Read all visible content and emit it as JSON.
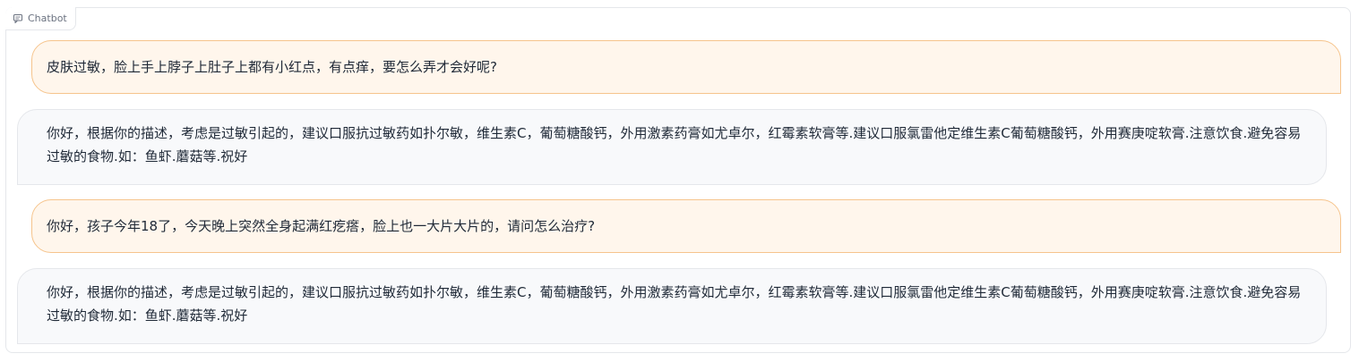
{
  "panel": {
    "label": "Chatbot",
    "icon": "chat-icon"
  },
  "messages": [
    {
      "role": "user",
      "text": "皮肤过敏，脸上手上脖子上肚子上都有小红点，有点痒，要怎么弄才会好呢?"
    },
    {
      "role": "bot",
      "text": "你好，根据你的描述，考虑是过敏引起的，建议口服抗过敏药如扑尔敏，维生素C，葡萄糖酸钙，外用激素药膏如尤卓尔，红霉素软膏等.建议口服氯雷他定维生素C葡萄糖酸钙，外用赛庚啶软膏.注意饮食.避免容易过敏的食物.如：鱼虾.蘑菇等.祝好"
    },
    {
      "role": "user",
      "text": "你好，孩子今年18了，今天晚上突然全身起满红疙瘩，脸上也一大片大片的，请问怎么治疗?"
    },
    {
      "role": "bot",
      "text": "你好，根据你的描述，考虑是过敏引起的，建议口服抗过敏药如扑尔敏，维生素C，葡萄糖酸钙，外用激素药膏如尤卓尔，红霉素软膏等.建议口服氯雷他定维生素C葡萄糖酸钙，外用赛庚啶软膏.注意饮食.避免容易过敏的食物.如：鱼虾.蘑菇等.祝好"
    }
  ],
  "colors": {
    "user_bubble_bg": "#fff6ec",
    "user_bubble_border": "#f6c48c",
    "bot_bubble_bg": "#f8f9fb",
    "bot_bubble_border": "#e5e7eb"
  }
}
